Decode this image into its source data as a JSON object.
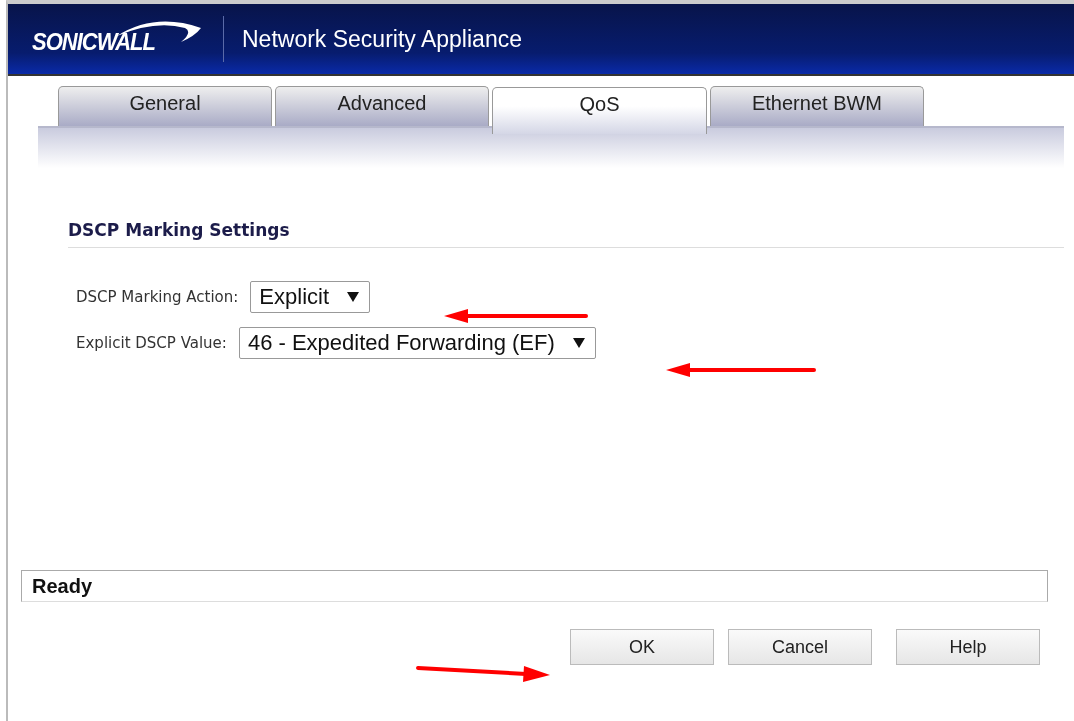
{
  "header": {
    "logo": "SONICWALL",
    "title": "Network Security Appliance"
  },
  "tabs": [
    {
      "label": "General",
      "selected": false
    },
    {
      "label": "Advanced",
      "selected": false
    },
    {
      "label": "QoS",
      "selected": true
    },
    {
      "label": "Ethernet BWM",
      "selected": false
    }
  ],
  "section": {
    "title": "DSCP Marking Settings"
  },
  "fields": [
    {
      "label": "DSCP Marking Action:",
      "value": "Explicit"
    },
    {
      "label": "Explicit DSCP Value:",
      "value": "46 - Expedited Forwarding (EF)"
    }
  ],
  "status_bar": "Ready",
  "buttons": [
    "OK",
    "Cancel",
    "Help"
  ]
}
